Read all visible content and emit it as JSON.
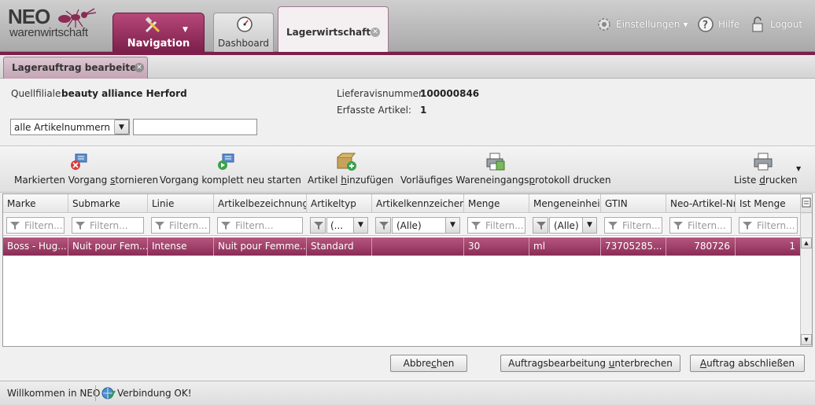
{
  "header": {
    "logo_main": "NEO",
    "logo_sub": "warenwirtschaft",
    "tabs": [
      {
        "label": "Navigation",
        "icon": "tools-icon"
      },
      {
        "label": "Dashboard",
        "icon": "gauge-icon"
      },
      {
        "label": "Lagerwirtschaft"
      }
    ],
    "right": {
      "settings": "Einstellungen",
      "help": "Hilfe",
      "logout": "Logout"
    }
  },
  "subtab": {
    "label": "Lagerauftrag bearbeiten"
  },
  "info": {
    "source_label": "Quellfiliale:",
    "source_value": "beauty alliance Herford",
    "avis_label": "Lieferavisnummer:",
    "avis_value": "100000846",
    "captured_label": "Erfasste Artikel:",
    "captured_value": "1",
    "filter_combo": "alle Artikelnummern",
    "filter_text": ""
  },
  "toolbar": {
    "cancel_marked_pre": "Markierten Vorgang ",
    "cancel_marked_key": "s",
    "cancel_marked_post": "tornieren",
    "restart_pre": "Vorgang komplett neu starten",
    "add_pre": "Artikel ",
    "add_key": "h",
    "add_post": "inzufügen",
    "print_proto_pre": "Vorläufiges Wareneingangs",
    "print_proto_key": "p",
    "print_proto_post": "rotokoll drucken",
    "print_list_pre": "Liste ",
    "print_list_key": "d",
    "print_list_post": "rucken"
  },
  "grid": {
    "columns": [
      "Marke",
      "Submarke",
      "Linie",
      "Artikelbezeichnung",
      "Artikeltyp",
      "Artikelkennzeichen",
      "Menge",
      "Mengeneinheit",
      "GTIN",
      "Neo-Artikel-Nr.",
      "Ist Menge"
    ],
    "filter_placeholder": "Filtern...",
    "filter_type_value": "(...",
    "filter_all_value": "(Alle)",
    "rows": [
      {
        "marke": "Boss - Hug...",
        "submarke": "Nuit pour Fem...",
        "linie": "Intense",
        "bezeichnung": "Nuit pour Femme...",
        "typ": "Standard",
        "kennzeichen": "",
        "menge": "30",
        "einheit": "ml",
        "gtin": "73705285...",
        "neo_nr": "780726",
        "ist_menge": "1"
      }
    ]
  },
  "buttons": {
    "abort_pre": "Abbre",
    "abort_key": "c",
    "abort_post": "hen",
    "interrupt_pre": "Auftragsbearbeitung ",
    "interrupt_key": "u",
    "interrupt_post": "nterbrechen",
    "finish_pre": "",
    "finish_key": "A",
    "finish_post": "uftrag abschließen"
  },
  "status": {
    "welcome": "Willkommen in NEO",
    "connection": "Verbindung OK!"
  },
  "colors": {
    "accent": "#8a2c55",
    "header_bg": "#bdbdbd"
  }
}
